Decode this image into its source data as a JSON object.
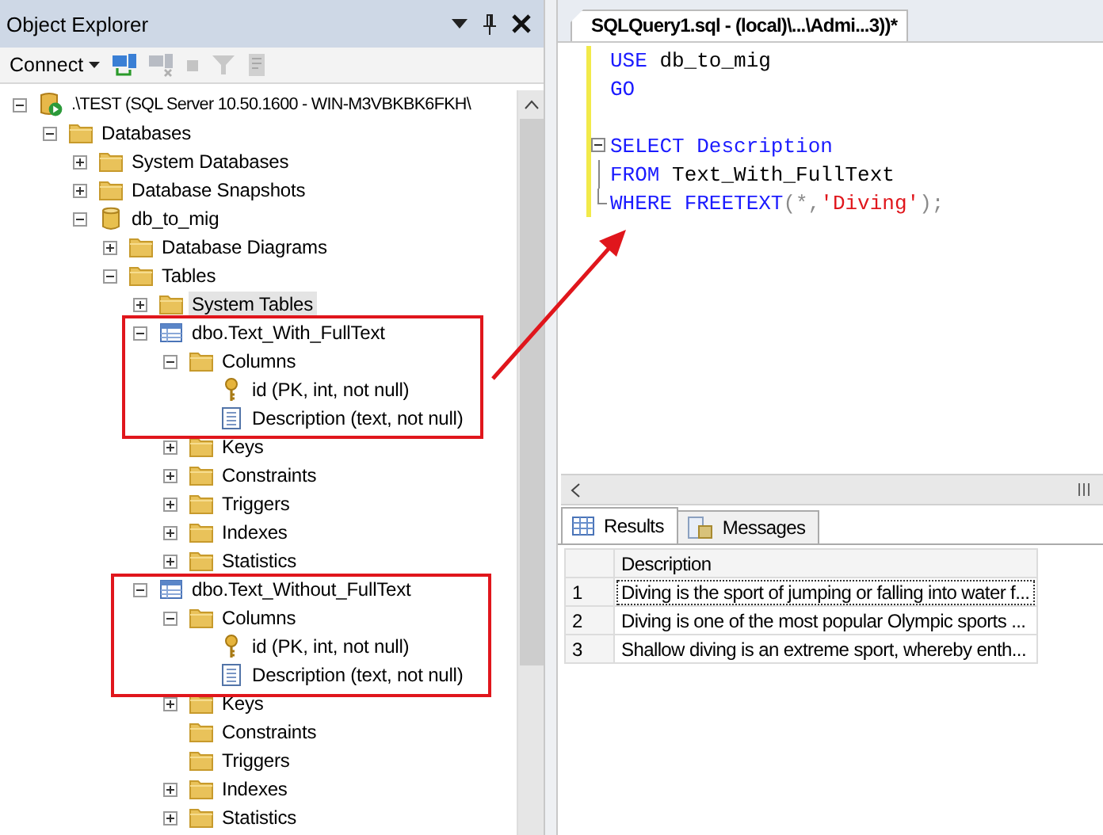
{
  "object_explorer": {
    "title": "Object Explorer",
    "toolbar": {
      "connect_label": "Connect"
    },
    "tree": [
      {
        "kind": "server",
        "label": ".\\TEST (SQL Server 10.50.1600 - WIN-M3VBKBK6FKH\\",
        "expanded": true,
        "selected": false,
        "children": [
          {
            "kind": "folder",
            "label": "Databases",
            "expanded": true,
            "selected": false,
            "children": [
              {
                "kind": "folder",
                "label": "System Databases",
                "expanded": false,
                "selected": false
              },
              {
                "kind": "folder",
                "label": "Database Snapshots",
                "expanded": false,
                "selected": false
              },
              {
                "kind": "database",
                "label": "db_to_mig",
                "expanded": true,
                "selected": false,
                "children": [
                  {
                    "kind": "folder",
                    "label": "Database Diagrams",
                    "expanded": false,
                    "selected": false
                  },
                  {
                    "kind": "folder",
                    "label": "Tables",
                    "expanded": true,
                    "selected": false,
                    "children": [
                      {
                        "kind": "folder",
                        "label": "System Tables",
                        "expanded": false,
                        "selected": true
                      },
                      {
                        "kind": "table",
                        "label": "dbo.Text_With_FullText",
                        "expanded": true,
                        "selected": false,
                        "children": [
                          {
                            "kind": "folder",
                            "label": "Columns",
                            "expanded": true,
                            "selected": false,
                            "children": [
                              {
                                "kind": "key",
                                "label": "id (PK, int, not null)",
                                "selected": false
                              },
                              {
                                "kind": "column",
                                "label": "Description (text, not null)",
                                "selected": false
                              }
                            ]
                          },
                          {
                            "kind": "folder",
                            "label": "Keys",
                            "expanded": false,
                            "selected": false
                          },
                          {
                            "kind": "folder",
                            "label": "Constraints",
                            "expanded": false,
                            "selected": false
                          },
                          {
                            "kind": "folder",
                            "label": "Triggers",
                            "expanded": false,
                            "selected": false
                          },
                          {
                            "kind": "folder",
                            "label": "Indexes",
                            "expanded": false,
                            "selected": false
                          },
                          {
                            "kind": "folder",
                            "label": "Statistics",
                            "expanded": false,
                            "selected": false
                          }
                        ]
                      },
                      {
                        "kind": "table",
                        "label": "dbo.Text_Without_FullText",
                        "expanded": true,
                        "selected": false,
                        "children": [
                          {
                            "kind": "folder",
                            "label": "Columns",
                            "expanded": true,
                            "selected": false,
                            "children": [
                              {
                                "kind": "key",
                                "label": "id (PK, int, not null)",
                                "selected": false
                              },
                              {
                                "kind": "column",
                                "label": "Description (text, not null)",
                                "selected": false
                              }
                            ]
                          },
                          {
                            "kind": "folder",
                            "label": "Keys",
                            "expanded": false,
                            "selected": false
                          },
                          {
                            "kind": "folder",
                            "label": "Constraints",
                            "selected": false
                          },
                          {
                            "kind": "folder",
                            "label": "Triggers",
                            "selected": false
                          },
                          {
                            "kind": "folder",
                            "label": "Indexes",
                            "expanded": false,
                            "selected": false
                          },
                          {
                            "kind": "folder",
                            "label": "Statistics",
                            "expanded": false,
                            "selected": false
                          }
                        ]
                      }
                    ]
                  }
                ]
              }
            ]
          }
        ]
      }
    ]
  },
  "editor": {
    "tab": {
      "title": "SQLQuery1.sql - (local)\\...\\Admi...3))*",
      "selected": true
    },
    "lines": [
      {
        "changed": true,
        "kind": "code",
        "tokens": [
          {
            "kind": "keyword",
            "text": "USE"
          },
          {
            "kind": "plain",
            "text": " db_to_mig"
          }
        ]
      },
      {
        "changed": true,
        "kind": "code",
        "tokens": [
          {
            "kind": "keyword",
            "text": "GO"
          }
        ]
      },
      {
        "changed": true,
        "kind": "blank"
      },
      {
        "changed": true,
        "kind": "fold-start",
        "tokens": [
          {
            "kind": "keyword",
            "text": "SELECT"
          },
          {
            "kind": "keyword",
            "text": " Description"
          }
        ]
      },
      {
        "changed": true,
        "kind": "fold-middle",
        "tokens": [
          {
            "kind": "keyword",
            "text": "FROM"
          },
          {
            "kind": "plain",
            "text": " Text_With_FullText"
          }
        ]
      },
      {
        "changed": true,
        "kind": "fold-end",
        "tokens": [
          {
            "kind": "keyword",
            "text": "WHERE"
          },
          {
            "kind": "keyword",
            "text": " FREETEXT"
          },
          {
            "kind": "operator",
            "text": "(*,"
          },
          {
            "kind": "string",
            "text": "'Diving'"
          },
          {
            "kind": "operator",
            "text": ");"
          }
        ]
      }
    ]
  },
  "results": {
    "tabs": [
      {
        "label": "Results",
        "kind": "grid",
        "selected": true
      },
      {
        "label": "Messages",
        "kind": "messages",
        "selected": false
      }
    ],
    "columns": [
      "Description"
    ],
    "rows": [
      {
        "number": "1",
        "description": "Diving is the sport of jumping or falling into water f...",
        "selected": true
      },
      {
        "number": "2",
        "description": "Diving is one of the most popular Olympic sports ...",
        "selected": false
      },
      {
        "number": "3",
        "description": "Shallow diving is an extreme sport, whereby enth...",
        "selected": false
      }
    ]
  }
}
